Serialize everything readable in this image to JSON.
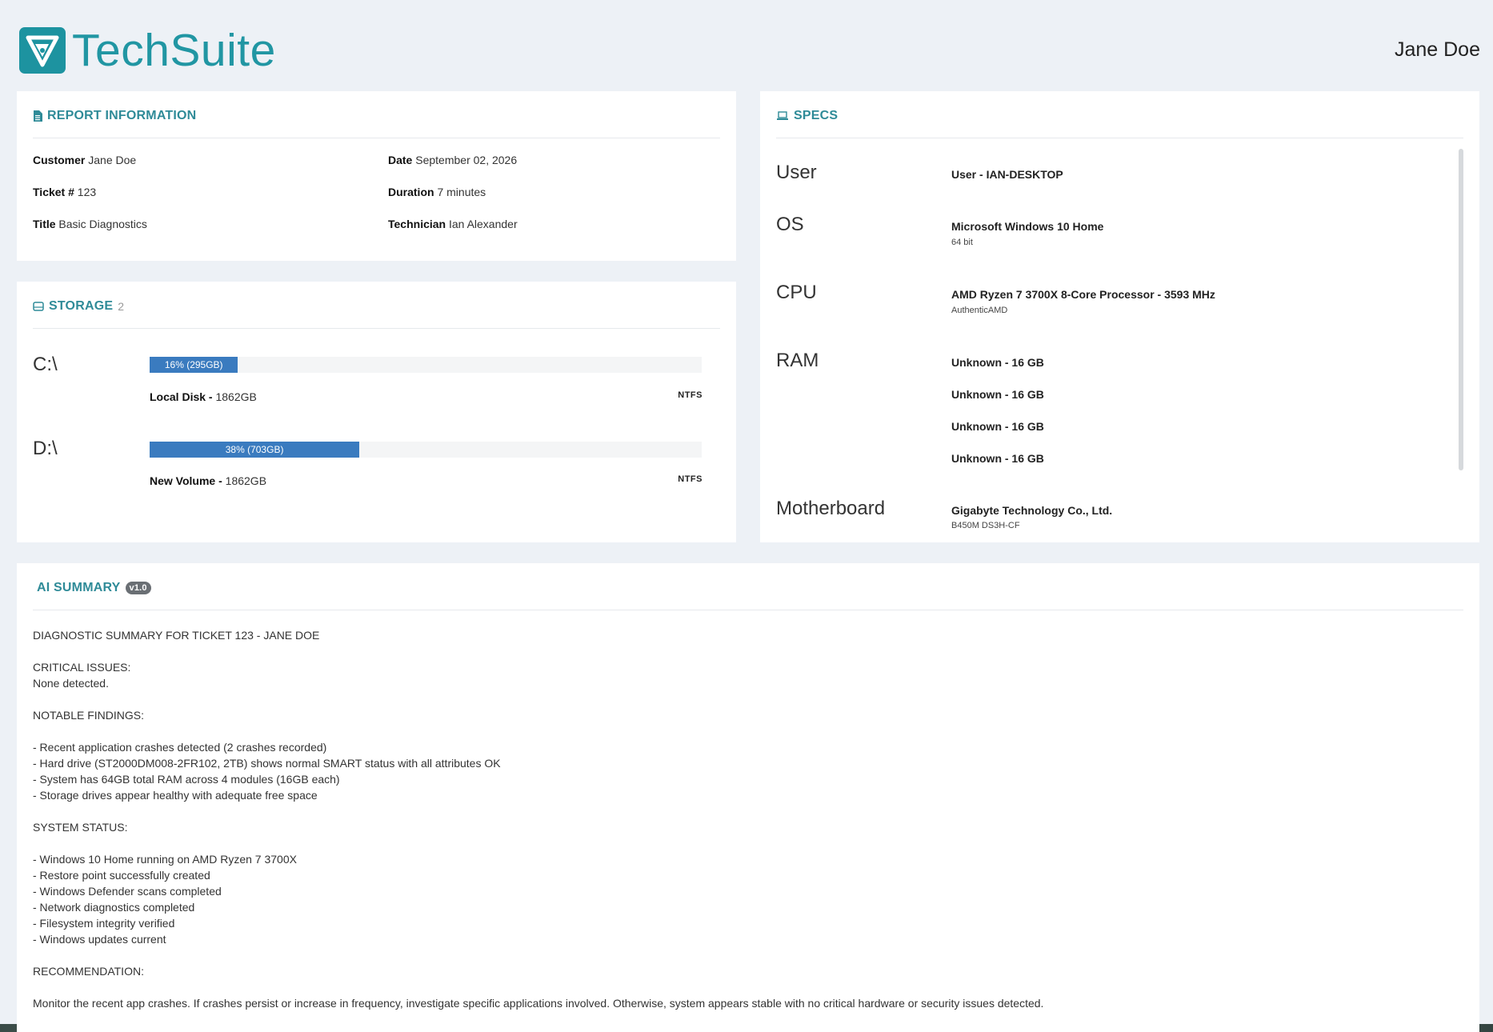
{
  "header": {
    "app_name": "TechSuite",
    "user_name": "Jane Doe"
  },
  "report": {
    "title": "REPORT INFORMATION",
    "fields": {
      "customer": {
        "label": "Customer",
        "value": "Jane Doe"
      },
      "ticket": {
        "label": "Ticket #",
        "value": "123"
      },
      "title": {
        "label": "Title",
        "value": "Basic Diagnostics"
      },
      "date": {
        "label": "Date",
        "value": "September 02, 2026"
      },
      "duration": {
        "label": "Duration",
        "value": "7 minutes"
      },
      "technician": {
        "label": "Technician",
        "value": "Ian Alexander"
      }
    }
  },
  "storage": {
    "title": "STORAGE",
    "count": "2",
    "drives": [
      {
        "letter": "C:\\",
        "usage_label": "16% (295GB)",
        "usage_percent": 16,
        "name": "Local Disk -",
        "size": "1862GB",
        "fs": "NTFS"
      },
      {
        "letter": "D:\\",
        "usage_label": "38% (703GB)",
        "usage_percent": 38,
        "name": "New Volume -",
        "size": "1862GB",
        "fs": "NTFS"
      }
    ]
  },
  "specs": {
    "title": "SPECS",
    "user": {
      "label": "User",
      "value": "User - IAN-DESKTOP"
    },
    "os": {
      "label": "OS",
      "value": "Microsoft Windows 10 Home",
      "sub": "64 bit"
    },
    "cpu": {
      "label": "CPU",
      "value": "AMD Ryzen 7 3700X 8-Core Processor - 3593 MHz",
      "sub": "AuthenticAMD"
    },
    "ram": {
      "label": "RAM",
      "modules": [
        "Unknown - 16 GB",
        "Unknown - 16 GB",
        "Unknown - 16 GB",
        "Unknown - 16 GB"
      ]
    },
    "motherboard": {
      "label": "Motherboard",
      "value": "Gigabyte Technology Co., Ltd.",
      "sub": "B450M DS3H-CF"
    }
  },
  "ai_summary": {
    "title": "AI SUMMARY",
    "version": "v1.0",
    "text": "DIAGNOSTIC SUMMARY FOR TICKET 123 - JANE DOE\n\nCRITICAL ISSUES:\nNone detected.\n\nNOTABLE FINDINGS:\n\n- Recent application crashes detected (2 crashes recorded)\n- Hard drive (ST2000DM008-2FR102, 2TB) shows normal SMART status with all attributes OK\n- System has 64GB total RAM across 4 modules (16GB each)\n- Storage drives appear healthy with adequate free space\n\nSYSTEM STATUS:\n\n- Windows 10 Home running on AMD Ryzen 7 3700X\n- Restore point successfully created\n- Windows Defender scans completed\n- Network diagnostics completed\n- Filesystem integrity verified\n- Windows updates current\n\nRECOMMENDATION:\n\nMonitor the recent app crashes. If crashes persist or increase in frequency, investigate specific applications involved. Otherwise, system appears stable with no critical hardware or security issues detected."
  },
  "colors": {
    "brand": "#2196a3",
    "bar": "#3a7bbf",
    "title": "#2f8b98"
  },
  "icons": {
    "logo": "techsuite-logo-icon",
    "report": "document-icon",
    "storage": "hard-drive-icon",
    "specs": "laptop-icon"
  }
}
